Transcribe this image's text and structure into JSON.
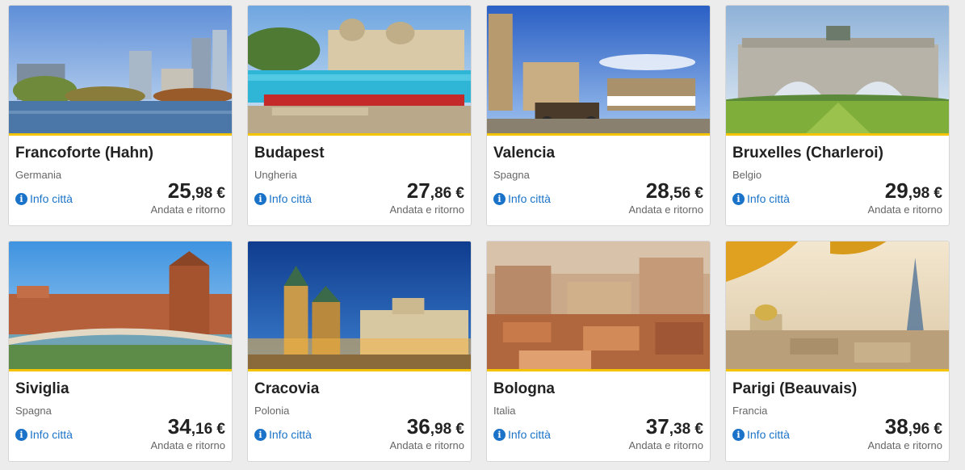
{
  "destinations": [
    {
      "city": "Francoforte (Hahn)",
      "country": "Germania",
      "info": "Info città",
      "price_whole": "25",
      "price_cents": ",98",
      "currency": " €",
      "trip": "Andata e ritorno"
    },
    {
      "city": "Budapest",
      "country": "Ungheria",
      "info": "Info città",
      "price_whole": "27",
      "price_cents": ",86",
      "currency": " €",
      "trip": "Andata e ritorno"
    },
    {
      "city": "Valencia",
      "country": "Spagna",
      "info": "Info città",
      "price_whole": "28",
      "price_cents": ",56",
      "currency": " €",
      "trip": "Andata e ritorno"
    },
    {
      "city": "Bruxelles (Charleroi)",
      "country": "Belgio",
      "info": "Info città",
      "price_whole": "29",
      "price_cents": ",98",
      "currency": " €",
      "trip": "Andata e ritorno"
    },
    {
      "city": "Siviglia",
      "country": "Spagna",
      "info": "Info città",
      "price_whole": "34",
      "price_cents": ",16",
      "currency": " €",
      "trip": "Andata e ritorno"
    },
    {
      "city": "Cracovia",
      "country": "Polonia",
      "info": "Info città",
      "price_whole": "36",
      "price_cents": ",98",
      "currency": " €",
      "trip": "Andata e ritorno"
    },
    {
      "city": "Bologna",
      "country": "Italia",
      "info": "Info città",
      "price_whole": "37",
      "price_cents": ",38",
      "currency": " €",
      "trip": "Andata e ritorno"
    },
    {
      "city": "Parigi (Beauvais)",
      "country": "Francia",
      "info": "Info città",
      "price_whole": "38",
      "price_cents": ",96",
      "currency": " €",
      "trip": "Andata e ritorno"
    }
  ],
  "colors": {
    "accent": "#f5c400",
    "link": "#1a73c9"
  },
  "icons": {
    "info": "info-icon"
  }
}
